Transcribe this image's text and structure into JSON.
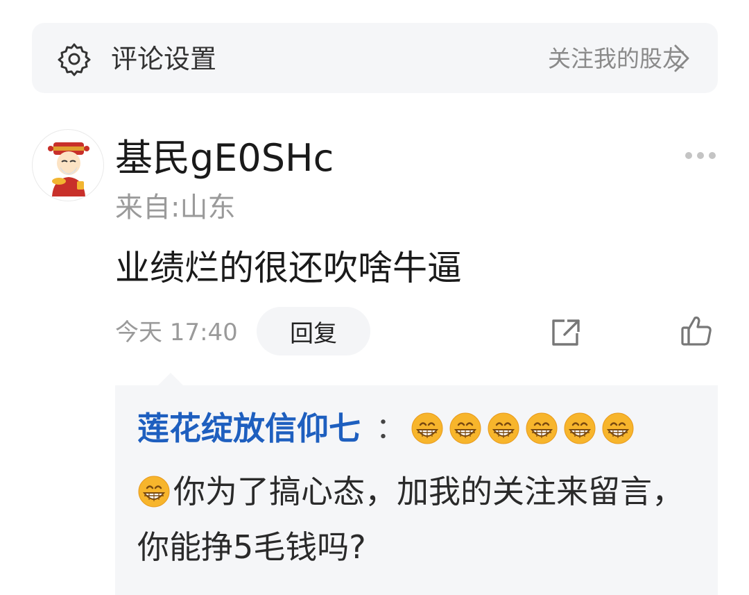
{
  "settings_bar": {
    "icon": "gear-icon",
    "title": "评论设置",
    "link_label": "关注我的股友",
    "link_icon": "chevron-right-icon"
  },
  "comment": {
    "avatar_icon": "fortune-god-avatar",
    "username": "基民gE0SHc",
    "location": "来自:山东",
    "text": "业绩烂的很还吹啥牛逼",
    "time": "今天 17:40",
    "reply_label": "回复",
    "more_icon": "more-dots-icon",
    "share_icon": "share-icon",
    "like_icon": "thumbs-up-icon"
  },
  "reply": {
    "username": "莲花绽放信仰七",
    "colon": "：",
    "leading_emoji_count": 6,
    "emoji_icon": "grinning-emoji-icon",
    "text": "你为了搞心态，加我的关注来留言，你能挣5毛钱吗?"
  },
  "colors": {
    "reply_username": "#1e5fbf",
    "settings_bg": "#f5f6f8",
    "emoji": "#f7b52c"
  }
}
